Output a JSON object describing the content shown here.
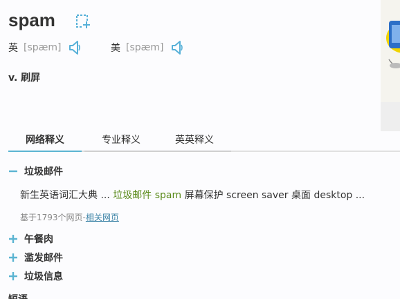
{
  "entry": {
    "word": "spam",
    "definition": "v. 刷屏"
  },
  "pronunciations": [
    {
      "region": "英",
      "phonetic": "[spæm]"
    },
    {
      "region": "美",
      "phonetic": "[spæm]"
    }
  ],
  "tabs": [
    {
      "label": "网络释义",
      "active": true
    },
    {
      "label": "专业释义",
      "active": false
    },
    {
      "label": "英英释义",
      "active": false
    }
  ],
  "web_meanings": {
    "expanded": {
      "label": "垃圾邮件",
      "source_prefix": "新生英语词汇大典 ... ",
      "source_highlight": "垃圾邮件 spam",
      "source_suffix": " 屏幕保护 screen saver 桌面 desktop ...",
      "count_text": "基于1793个网页-",
      "related_link": "相关网页"
    },
    "collapsed": [
      {
        "label": "午餐肉"
      },
      {
        "label": "滥发邮件"
      },
      {
        "label": "垃圾信息"
      }
    ],
    "next_section_label": "短语"
  },
  "colors": {
    "accent": "#5bb4d2",
    "highlight": "#5a8a1a",
    "link": "#3a82a6",
    "speaker": "#56b0d8"
  }
}
